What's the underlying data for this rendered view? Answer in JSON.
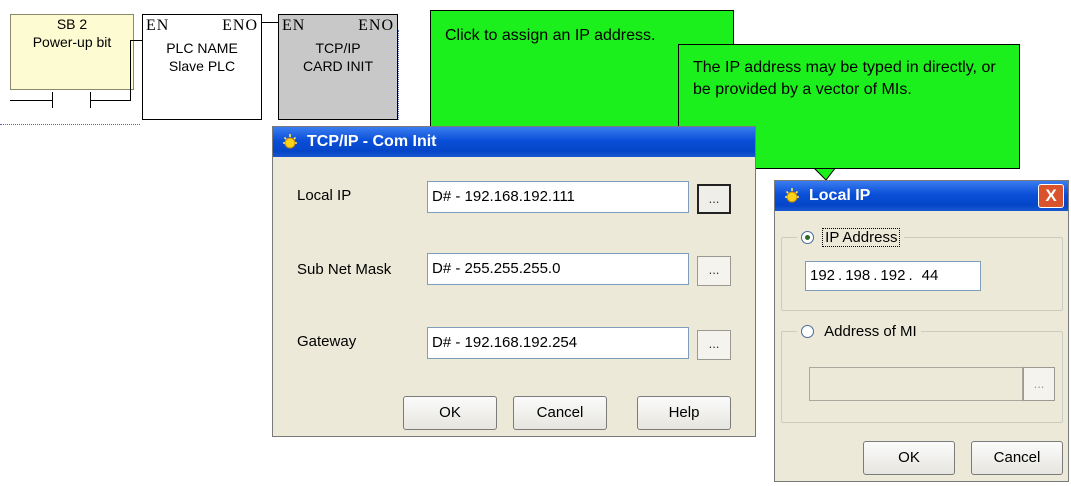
{
  "ladder": {
    "sb2": {
      "line1": "SB 2",
      "line2": "Power-up bit"
    },
    "plc_name": {
      "en": "EN",
      "eno": "ENO",
      "line1": "PLC NAME",
      "line2": "Slave PLC"
    },
    "tcpip_init": {
      "en": "EN",
      "eno": "ENO",
      "line1": "TCP/IP",
      "line2": "CARD INIT"
    }
  },
  "callouts": {
    "assign": "Click to assign an IP address.",
    "typed": "The IP address may be typed in directly, or be provided by a vector of MIs."
  },
  "com_init_dialog": {
    "title": "TCP/IP - Com Init",
    "local_ip_label": "Local IP",
    "local_ip_value": "D# - 192.168.192.111",
    "subnet_label": "Sub Net Mask",
    "subnet_value": "D# - 255.255.255.0",
    "gateway_label": "Gateway",
    "gateway_value": "D# - 192.168.192.254",
    "browse_label": "...",
    "ok_label": "OK",
    "cancel_label": "Cancel",
    "help_label": "Help"
  },
  "local_ip_dialog": {
    "title": "Local IP",
    "close_label": "X",
    "ip_address_option": "IP Address",
    "ip_octets": [
      "192",
      "198",
      "192",
      "44"
    ],
    "mi_option": "Address of MI",
    "mi_value": "",
    "browse_label": "...",
    "ok_label": "OK",
    "cancel_label": "Cancel"
  },
  "colors": {
    "callout_green": "#1cf01c",
    "titlebar_blue": "#0a4fd8",
    "dialog_bg": "#ece9d8",
    "close_red": "#d9532c"
  }
}
